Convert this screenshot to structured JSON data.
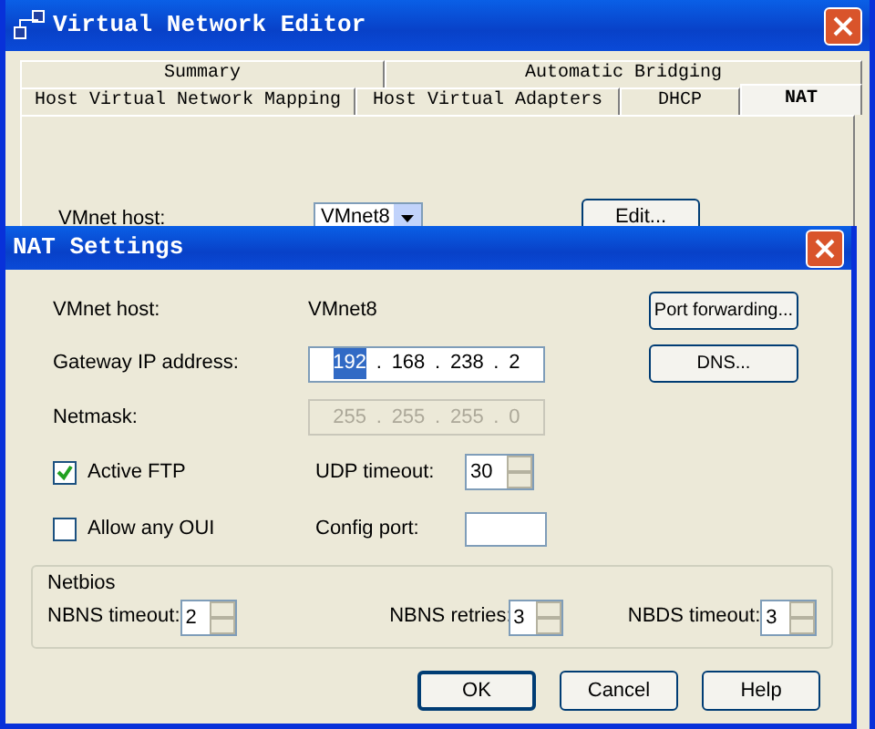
{
  "window": {
    "title": "Virtual Network Editor"
  },
  "tabs_row_1": [
    {
      "label": "Summary",
      "selected": false
    },
    {
      "label": "Automatic Bridging",
      "selected": false
    }
  ],
  "tabs_row_2": [
    {
      "label": "Host Virtual Network Mapping",
      "selected": false
    },
    {
      "label": "Host Virtual Adapters",
      "selected": false
    },
    {
      "label": "DHCP",
      "selected": false
    },
    {
      "label": "NAT",
      "selected": true
    }
  ],
  "vmnet_host": {
    "label": "VMnet host:",
    "value": "VMnet8"
  },
  "edit_button": "Edit...",
  "dialog": {
    "title": "NAT Settings",
    "vmnet_host": {
      "label": "VMnet host:",
      "value": "VMnet8"
    },
    "gateway": {
      "label": "Gateway IP address:",
      "disabled": false,
      "separators": [
        ".",
        ".",
        "."
      ],
      "octets": [
        {
          "text": "192",
          "selected": true
        },
        {
          "text": "168",
          "selected": false
        },
        {
          "text": "238",
          "selected": false
        },
        {
          "text": "2",
          "selected": false
        }
      ]
    },
    "netmask": {
      "label": "Netmask:",
      "disabled": true,
      "separators": [
        ".",
        ".",
        "."
      ],
      "octets": [
        {
          "text": "255",
          "selected": false
        },
        {
          "text": "255",
          "selected": false
        },
        {
          "text": "255",
          "selected": false
        },
        {
          "text": "0",
          "selected": false
        }
      ]
    },
    "port_forwarding_button": "Port forwarding...",
    "dns_button": "DNS...",
    "active_ftp": {
      "label": "Active FTP",
      "checked": true
    },
    "allow_any_oui": {
      "label": "Allow any OUI",
      "checked": false
    },
    "udp_timeout": {
      "label": "UDP timeout:",
      "value": "30"
    },
    "config_port": {
      "label": "Config port:"
    },
    "netbios": {
      "title": "Netbios",
      "spinners": [
        {
          "label": "NBNS timeout:",
          "value": "2"
        },
        {
          "label": "NBNS retries:",
          "value": "3"
        },
        {
          "label": "NBDS timeout:",
          "value": "3"
        }
      ]
    },
    "buttons": [
      {
        "label": "OK",
        "default": true
      },
      {
        "label": "Cancel",
        "default": false
      },
      {
        "label": "Help",
        "default": false
      }
    ]
  }
}
